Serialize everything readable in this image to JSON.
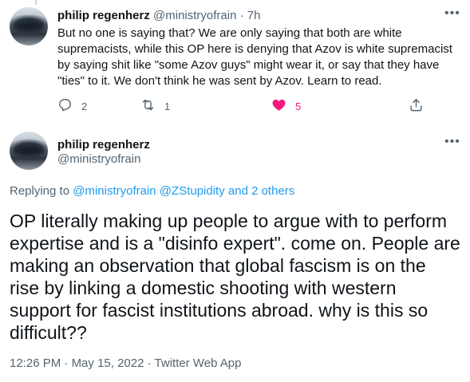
{
  "reply_tweet": {
    "author_name": "philip regenherz",
    "author_handle": "@ministryofrain",
    "separator": "·",
    "time_ago": "7h",
    "text": "But no one is saying that? We are only saying that both are white supremacists, while this OP here is denying that Azov is white supremacist by saying shit like \"some Azov guys\" might wear it, or say that they have \"ties\" to it. We don't think he was sent by Azov. Learn to read.",
    "reply_count": "2",
    "retweet_count": "1",
    "like_count": "5",
    "like_color": "#f91880",
    "icons": [
      "reply-icon",
      "retweet-icon",
      "heart-icon",
      "share-icon",
      "more-icon"
    ]
  },
  "main_tweet": {
    "author_name": "philip regenherz",
    "author_handle": "@ministryofrain",
    "replying_to_prefix": "Replying to",
    "replying_to_mentions": "@ministryofrain @ZStupidity and 2 others",
    "text": "OP literally making up people to argue with to perform expertise and is a \"disinfo expert\". come on. People are making an observation that global fascism is on the rise by linking a domestic shooting with western support for fascist institutions abroad. why is this so difficult??",
    "time": "12:26 PM",
    "date": "May 15, 2022",
    "source": "Twitter Web App",
    "separator": "·"
  },
  "colors": {
    "text_primary": "#0f1419",
    "text_secondary": "#536471",
    "link": "#1d9bf0",
    "like_active": "#f91880"
  }
}
